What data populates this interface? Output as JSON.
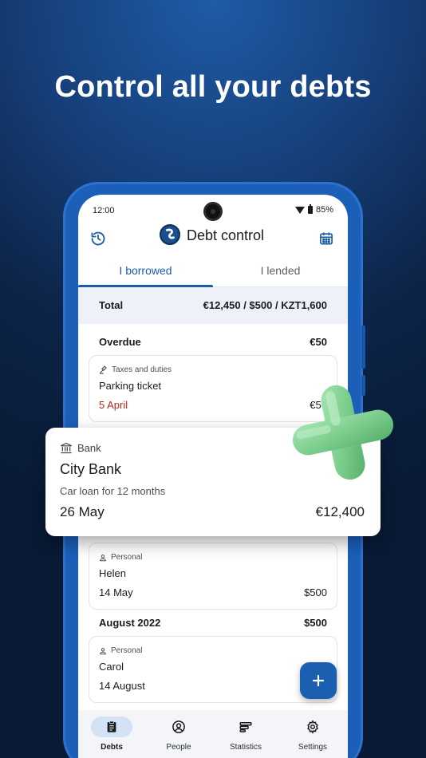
{
  "headline": "Control all your debts",
  "status_bar": {
    "time": "12:00",
    "battery": "85%"
  },
  "app_bar": {
    "title": "Debt control",
    "left_icon": "history-icon",
    "right_icon": "calendar-icon"
  },
  "tabs": [
    {
      "label": "I borrowed",
      "active": true
    },
    {
      "label": "I lended",
      "active": false
    }
  ],
  "total": {
    "label": "Total",
    "value": "€12,450 / $500 / KZT1,600"
  },
  "groups": [
    {
      "title": "Overdue",
      "amount": "€50",
      "cards": [
        {
          "category": "Taxes and duties",
          "category_icon": "gavel-icon",
          "name": "Parking ticket",
          "date": "5 April",
          "amount": "€50",
          "overdue": true
        }
      ]
    },
    {
      "cards": [
        {
          "category": "Personal",
          "category_icon": "person-icon",
          "name": "Helen",
          "date": "14 May",
          "amount": "$500"
        }
      ]
    },
    {
      "title": "August 2022",
      "amount": "$500",
      "cards": [
        {
          "category": "Personal",
          "category_icon": "person-icon",
          "name": "Carol",
          "date": "14 August",
          "amount": ""
        }
      ]
    }
  ],
  "highlight_card": {
    "category": "Bank",
    "category_icon": "bank-icon",
    "name": "City Bank",
    "description": "Car loan for 12 months",
    "date": "26 May",
    "amount": "€12,400"
  },
  "bottom_nav": [
    {
      "label": "Debts",
      "icon": "clipboard-icon",
      "active": true
    },
    {
      "label": "People",
      "icon": "person-circle-icon",
      "active": false
    },
    {
      "label": "Statistics",
      "icon": "statistics-icon",
      "active": false
    },
    {
      "label": "Settings",
      "icon": "gear-icon",
      "active": false
    }
  ],
  "colors": {
    "primary": "#1b5ba7",
    "overdue": "#b3261e",
    "accent_plus": "#7fd08f"
  }
}
